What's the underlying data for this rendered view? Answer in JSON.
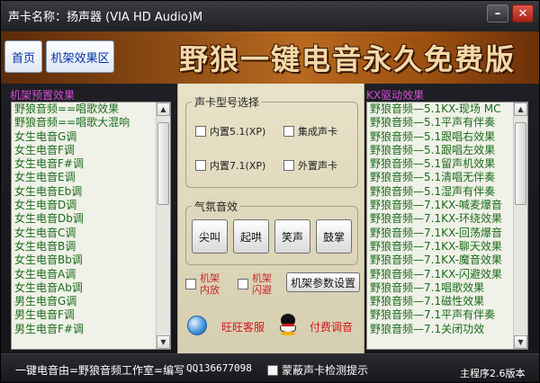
{
  "window": {
    "title": "声卡名称：扬声器 (VIA HD Audio)M",
    "minimize_glyph": "–",
    "close_glyph": "✕",
    "close_color": "#c7372b"
  },
  "nav": {
    "home_tab": "首页",
    "effects_tab": "机架效果区"
  },
  "banner": {
    "title": "野狼一键电音永久免费版"
  },
  "presets": {
    "label": "机架预置效果",
    "items": [
      "野狼音频==唱歌效果",
      "野狼音频==唱歌大混响",
      "女生电音G调",
      "女生电音F调",
      "女生电音F#调",
      "女生电音E调",
      "女生电音Eb调",
      "女生电音D调",
      "女生电音Db调",
      "女生电音C调",
      "女生电音B调",
      "女生电音Bb调",
      "女生电音A调",
      "女生电音Ab调",
      "男生电音G调",
      "男生电音F调",
      "男生电音F#调"
    ]
  },
  "kx": {
    "label": "KX驱动效果",
    "items": [
      "野狼音频—5.1KX-现场    MC",
      "野狼音频—5.1平声有伴奏",
      "野狼音频—5.1跟唱右效果",
      "野狼音频—5.1跟唱左效果",
      "野狼音频—5.1留声机效果",
      "野狼音频—5.1清唱无伴奏",
      "野狼音频—5.1湿声有伴奏",
      "野狼音频—7.1KX-喊麦爆音",
      "野狼音频—7.1KX-环绕效果",
      "野狼音频—7.1KX-回荡爆音",
      "野狼音频—7.1KX-聊天效果",
      "野狼音频—7.1KX-魔音效果",
      "野狼音频—7.1KX-闪避效果",
      "野狼音频—7.1唱歌效果",
      "野狼音频—7.1磁性效果",
      "野狼音频—7.1平声有伴奏",
      "野狼音频—7.1关闭功效"
    ]
  },
  "sound_card": {
    "title": "声卡型号选择",
    "options": {
      "internal_51": "内置5.1(XP)",
      "integrated": "集成声卡",
      "internal_71": "内置7.1(XP)",
      "external": "外置声卡"
    }
  },
  "atmosphere": {
    "title": "气氛音效",
    "buttons": {
      "scream": "尖叫",
      "boo": "起哄",
      "laugh": "笑声",
      "applause": "鼓掌"
    }
  },
  "rack": {
    "internal_label": "机架\n内放",
    "avoid_label": "机架\n闪避",
    "params_button": "机架参数设置"
  },
  "service": {
    "wangwang": "旺旺客服",
    "paid_tuning": "付费调音",
    "link_color": "#d2151c"
  },
  "footer": {
    "credit": "一键电音由=野狼音频工作室=编写",
    "qq": "QQ136677098",
    "shield_label": "蒙蔽声卡检测提示",
    "version": "主程序2.6版本"
  },
  "colors": {
    "list_text": "#1a6b1a",
    "section_label": "#d94bd9",
    "banner_text": "#f3d9a8"
  }
}
